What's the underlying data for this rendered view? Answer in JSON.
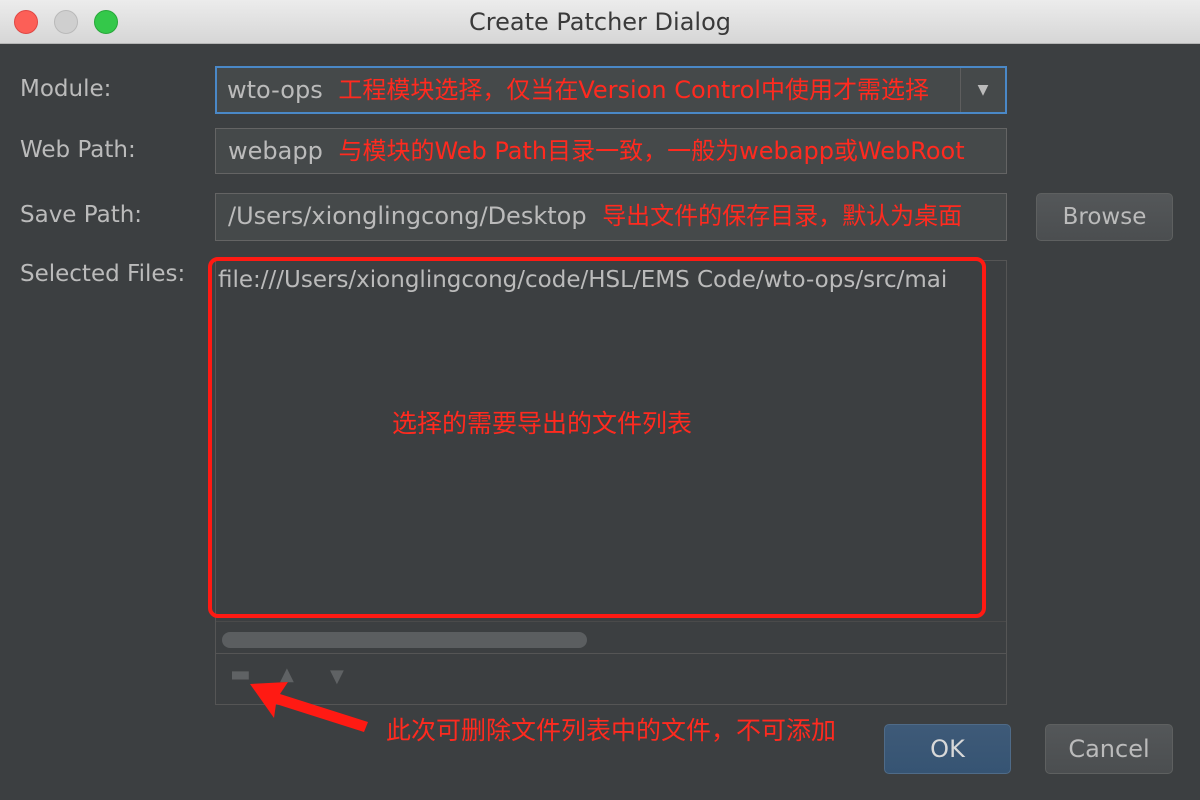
{
  "window": {
    "title": "Create Patcher Dialog"
  },
  "form": {
    "module_label": "Module:",
    "module_value": "wto-ops",
    "module_note": "工程模块选择，仅当在Version Control中使用才需选择",
    "web_path_label": "Web Path:",
    "web_path_value": "webapp",
    "web_path_note": "与模块的Web Path目录一致，一般为webapp或WebRoot",
    "save_path_label": "Save Path:",
    "save_path_value": "/Users/xionglingcong/Desktop",
    "save_path_note": "导出文件的保存目录，默认为桌面",
    "browse_label": "Browse",
    "selected_files_label": "Selected Files:"
  },
  "files": {
    "items": [
      "file:///Users/xionglingcong/code/HSL/EMS Code/wto-ops/src/mai"
    ],
    "list_note": "选择的需要导出的文件列表",
    "toolbar_note": "此次可删除文件列表中的文件，不可添加"
  },
  "icons": {
    "remove": "minus-icon",
    "up": "arrow-up-icon",
    "down": "arrow-down-icon"
  },
  "buttons": {
    "ok": "OK",
    "cancel": "Cancel"
  },
  "colors": {
    "annotation": "#ff1a13",
    "focus": "#4a88c7"
  }
}
